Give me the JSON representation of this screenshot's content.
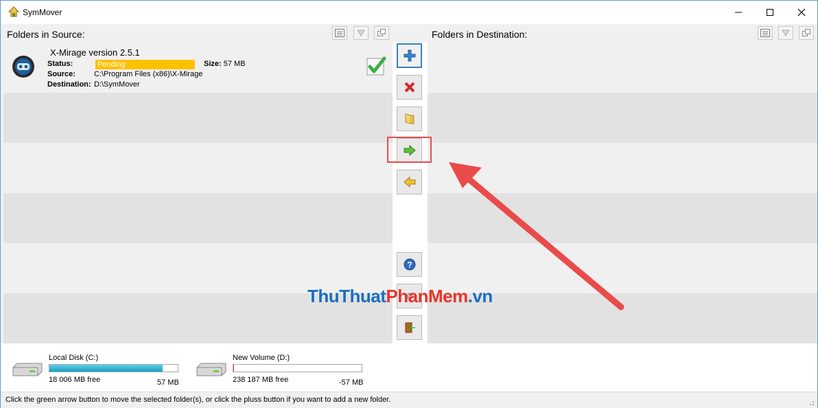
{
  "window": {
    "title": "SymMover"
  },
  "source": {
    "label": "Folders in Source:",
    "item": {
      "title": "X-Mirage version 2.5.1",
      "status_label": "Status:",
      "status_value": "Pending",
      "size_label": "Size:",
      "size_value": "57 MB",
      "source_label": "Source:",
      "source_value": "C:\\Program Files (x86)\\X-Mirage",
      "destination_label": "Destination:",
      "destination_value": "D:\\SymMover"
    }
  },
  "destination": {
    "label": "Folders in Destination:"
  },
  "disks": [
    {
      "name": "Local Disk (C:)",
      "free": "18 006 MB free",
      "delta": "57 MB",
      "used_fraction": 0.88
    },
    {
      "name": "New Volume (D:)",
      "free": "238 187 MB free",
      "delta": "-57 MB",
      "used_fraction": 0.005
    }
  ],
  "statusbar": {
    "text": "Click the green arrow button to move the selected folder(s), or click the pluss button if you want to add a new folder."
  },
  "watermark": {
    "part1": "ThuThuat",
    "part2": "PhanMem",
    "part3": ".vn"
  },
  "colors": {
    "accent": "#3c7fc6",
    "status_pending": "#ffc000",
    "highlight": "#e94b4b"
  }
}
